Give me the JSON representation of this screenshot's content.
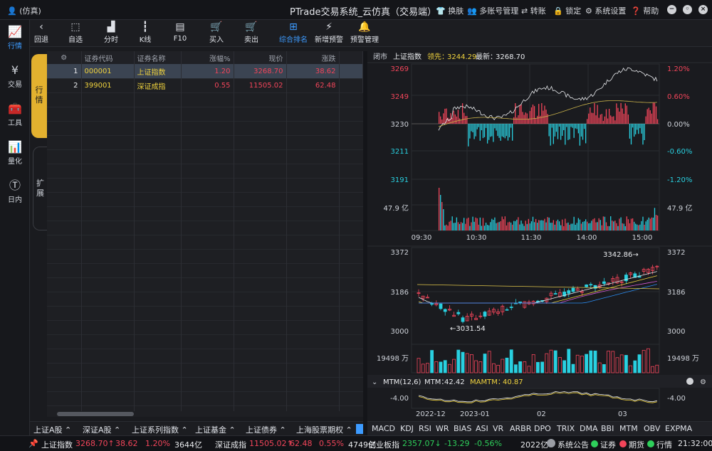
{
  "titlebar": {
    "user": "(仿真)",
    "title": "PTrade交易系统_云仿真（交易端）",
    "buttons": [
      "换肤",
      "多账号管理",
      "转账",
      "锁定",
      "系统设置",
      "帮助"
    ]
  },
  "nav": [
    {
      "label": "行情",
      "icon": "chart-icon",
      "active": true
    },
    {
      "label": "交易",
      "icon": "yen-icon"
    },
    {
      "label": "工具",
      "icon": "toolbox-icon"
    },
    {
      "label": "量化",
      "icon": "quant-icon"
    },
    {
      "label": "日内",
      "icon": "intraday-icon"
    }
  ],
  "toolbar": [
    {
      "label": "回退",
      "icon": "back-icon"
    },
    {
      "label": "自选",
      "icon": "watchlist-icon"
    },
    {
      "label": "分时",
      "icon": "timeshare-icon"
    },
    {
      "label": "K线",
      "icon": "candlestick-icon"
    },
    {
      "label": "F10",
      "icon": "f10-icon"
    },
    {
      "label": "买入",
      "icon": "buy-icon"
    },
    {
      "label": "卖出",
      "icon": "sell-icon"
    },
    {
      "label": "综合排名",
      "icon": "ranking-icon",
      "active": true
    },
    {
      "label": "新增预警",
      "icon": "alert-add-icon"
    },
    {
      "label": "预警管理",
      "icon": "alert-manage-icon"
    }
  ],
  "sidetabs": [
    "行\n情",
    "扩\n展"
  ],
  "table": {
    "headers": [
      "",
      "证券代码",
      "证券名称",
      "涨幅%",
      "现价",
      "涨跌"
    ],
    "rows": [
      [
        "1",
        "000001",
        "上证指数",
        "1.20",
        "3268.70",
        "38.62"
      ],
      [
        "2",
        "399001",
        "深证成指",
        "0.55",
        "11505.02",
        "62.48"
      ]
    ]
  },
  "bottom_tabs": [
    "上证A股",
    "深证A股",
    "上证系列指数",
    "上证基金",
    "上证债券",
    "上海股票期权"
  ],
  "indicators": [
    "MACD",
    "KDJ",
    "RSI",
    "WR",
    "BIAS",
    "ASI",
    "VR",
    "ARBR",
    "DPO",
    "TRIX",
    "DMA",
    "BBI",
    "MTM",
    "OBV",
    "EXPMA"
  ],
  "intraday": {
    "status": "闭市",
    "name": "上证指数",
    "lead_label": "领先：",
    "lead": "3244.29",
    "last_label": "最新：",
    "last": "3268.70",
    "ylabels_left": [
      "3269",
      "3249",
      "3230",
      "3211",
      "3191"
    ],
    "ylabels_right": [
      "1.20%",
      "0.60%",
      "0.00%",
      "-0.60%",
      "-1.20%"
    ],
    "vol_label": "47.9 亿",
    "times": [
      "09:30",
      "10:30",
      "11:30",
      "14:00",
      "15:00"
    ]
  },
  "kline": {
    "ylabels": [
      "3372",
      "3186",
      "3000"
    ],
    "high_note": "3342.86→",
    "low_note": "←3031.54",
    "vol_label": "19498 万",
    "ind_name": "MTM(12,6)",
    "mtm_label": "MTM：",
    "mtm": "42.42",
    "mamtm_label": "MAMTM：",
    "mamtm": "40.87",
    "ind_ylabel": "-4.00",
    "dates": [
      "2022-12",
      "2023-01",
      "02",
      "03"
    ]
  },
  "status": {
    "items": [
      {
        "name": "上证指数",
        "price": "3268.70↑",
        "chg": "38.62",
        "pct": "1.20%",
        "amt": "3644亿"
      },
      {
        "name": "深证成指",
        "price": "11505.02↑",
        "chg": "62.48",
        "pct": "0.55%",
        "amt": "4749亿"
      },
      {
        "name": "创业板指",
        "price": "2357.07↓",
        "chg": "-13.29",
        "pct": "-0.56%",
        "amt": "2022亿"
      }
    ],
    "notices": [
      "系统公告",
      "证券",
      "期货",
      "行情"
    ],
    "time": "21:32:00"
  },
  "colors": {
    "up": "#f2455a",
    "down": "#29d0e0",
    "accent": "#3d9bff",
    "tab": "#e3b12f"
  }
}
